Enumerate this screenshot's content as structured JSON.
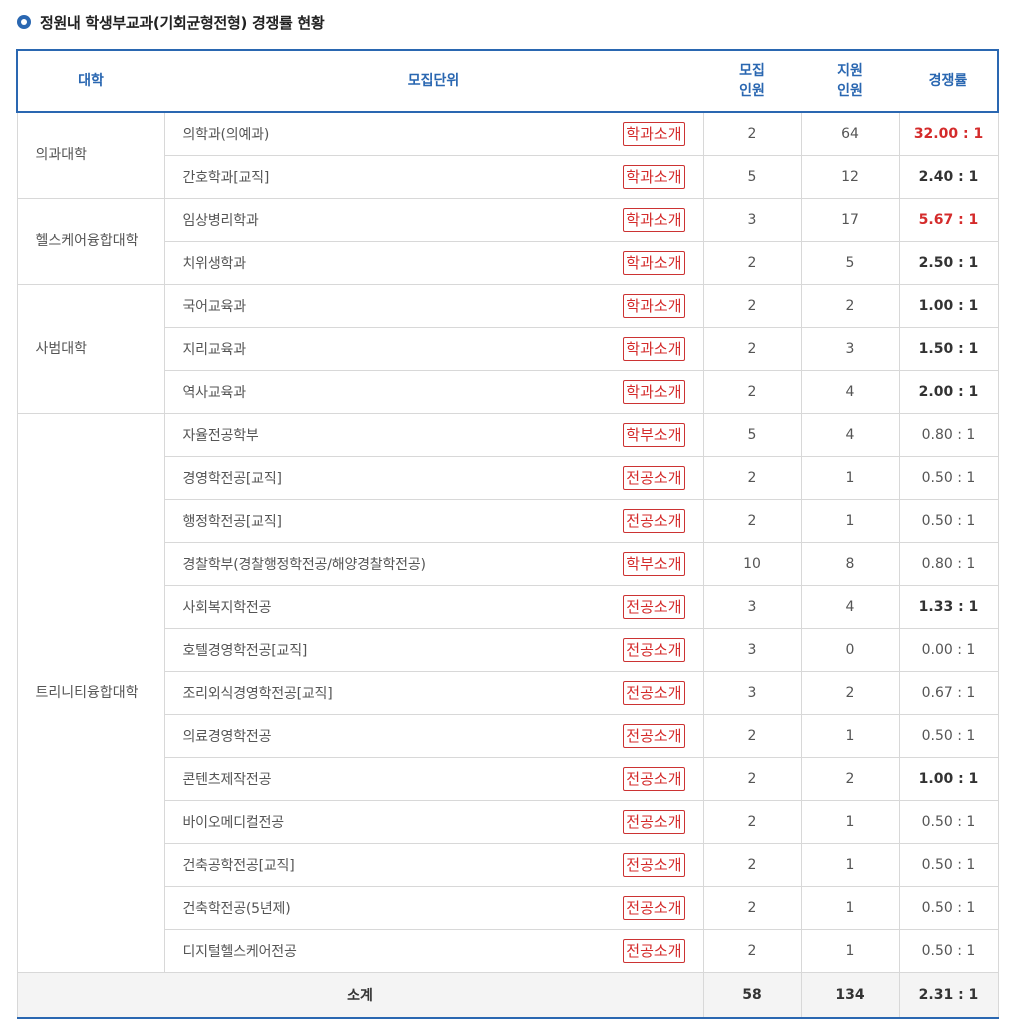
{
  "title": "정원내 학생부교과(기회균형전형) 경쟁률 현황",
  "colors": {
    "accent": "#2a67b1",
    "highlight": "#d42b2b"
  },
  "headers": {
    "college": "대학",
    "unit": "모집단위",
    "quota_line1": "모집",
    "quota_line2": "인원",
    "applicants_line1": "지원",
    "applicants_line2": "인원",
    "rate": "경쟁률"
  },
  "groups": [
    {
      "college": "의과대학",
      "rows": [
        {
          "unit": "의학과(의예과)",
          "button": "학과소개",
          "quota": "2",
          "applicants": "64",
          "rate": "32.00 : 1",
          "style": "hi"
        },
        {
          "unit": "간호학과[교직]",
          "button": "학과소개",
          "quota": "5",
          "applicants": "12",
          "rate": "2.40 : 1",
          "style": "bold"
        }
      ]
    },
    {
      "college": "헬스케어융합대학",
      "rows": [
        {
          "unit": "임상병리학과",
          "button": "학과소개",
          "quota": "3",
          "applicants": "17",
          "rate": "5.67 : 1",
          "style": "hi"
        },
        {
          "unit": "치위생학과",
          "button": "학과소개",
          "quota": "2",
          "applicants": "5",
          "rate": "2.50 : 1",
          "style": "bold"
        }
      ]
    },
    {
      "college": "사범대학",
      "rows": [
        {
          "unit": "국어교육과",
          "button": "학과소개",
          "quota": "2",
          "applicants": "2",
          "rate": "1.00 : 1",
          "style": "bold"
        },
        {
          "unit": "지리교육과",
          "button": "학과소개",
          "quota": "2",
          "applicants": "3",
          "rate": "1.50 : 1",
          "style": "bold"
        },
        {
          "unit": "역사교육과",
          "button": "학과소개",
          "quota": "2",
          "applicants": "4",
          "rate": "2.00 : 1",
          "style": "bold"
        }
      ]
    },
    {
      "college": "트리니티융합대학",
      "rows": [
        {
          "unit": "자율전공학부",
          "button": "학부소개",
          "quota": "5",
          "applicants": "4",
          "rate": "0.80 : 1",
          "style": "normal"
        },
        {
          "unit": "경영학전공[교직]",
          "button": "전공소개",
          "quota": "2",
          "applicants": "1",
          "rate": "0.50 : 1",
          "style": "normal"
        },
        {
          "unit": "행정학전공[교직]",
          "button": "전공소개",
          "quota": "2",
          "applicants": "1",
          "rate": "0.50 : 1",
          "style": "normal"
        },
        {
          "unit": "경찰학부(경찰행정학전공/해양경찰학전공)",
          "button": "학부소개",
          "quota": "10",
          "applicants": "8",
          "rate": "0.80 : 1",
          "style": "normal"
        },
        {
          "unit": "사회복지학전공",
          "button": "전공소개",
          "quota": "3",
          "applicants": "4",
          "rate": "1.33 : 1",
          "style": "bold"
        },
        {
          "unit": "호텔경영학전공[교직]",
          "button": "전공소개",
          "quota": "3",
          "applicants": "0",
          "rate": "0.00 : 1",
          "style": "normal"
        },
        {
          "unit": "조리외식경영학전공[교직]",
          "button": "전공소개",
          "quota": "3",
          "applicants": "2",
          "rate": "0.67 : 1",
          "style": "normal"
        },
        {
          "unit": "의료경영학전공",
          "button": "전공소개",
          "quota": "2",
          "applicants": "1",
          "rate": "0.50 : 1",
          "style": "normal"
        },
        {
          "unit": "콘텐츠제작전공",
          "button": "전공소개",
          "quota": "2",
          "applicants": "2",
          "rate": "1.00 : 1",
          "style": "bold"
        },
        {
          "unit": "바이오메디컬전공",
          "button": "전공소개",
          "quota": "2",
          "applicants": "1",
          "rate": "0.50 : 1",
          "style": "normal"
        },
        {
          "unit": "건축공학전공[교직]",
          "button": "전공소개",
          "quota": "2",
          "applicants": "1",
          "rate": "0.50 : 1",
          "style": "normal"
        },
        {
          "unit": "건축학전공(5년제)",
          "button": "전공소개",
          "quota": "2",
          "applicants": "1",
          "rate": "0.50 : 1",
          "style": "normal"
        },
        {
          "unit": "디지털헬스케어전공",
          "button": "전공소개",
          "quota": "2",
          "applicants": "1",
          "rate": "0.50 : 1",
          "style": "normal"
        }
      ]
    }
  ],
  "total": {
    "label": "소계",
    "quota": "58",
    "applicants": "134",
    "rate": "2.31 : 1"
  }
}
